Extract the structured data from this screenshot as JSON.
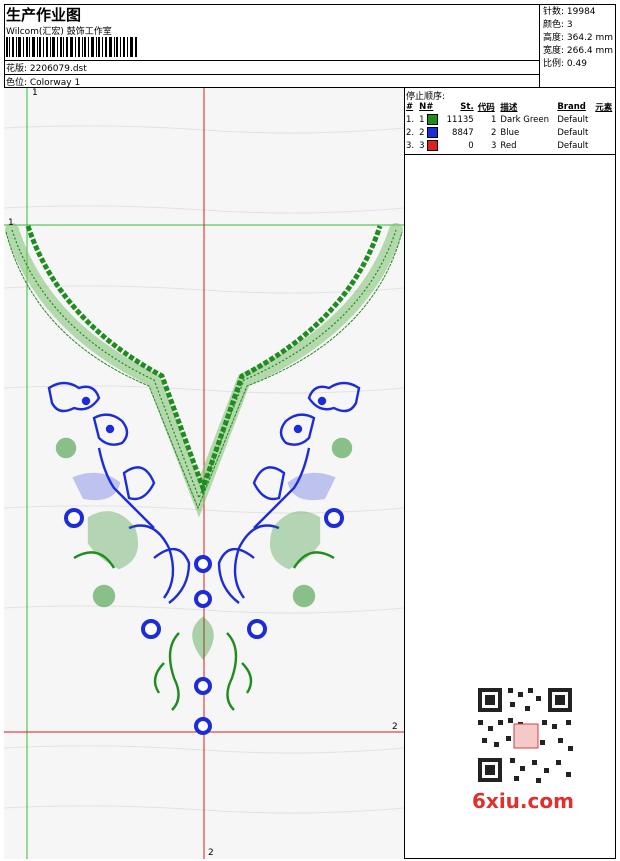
{
  "header": {
    "title": "生产作业图",
    "company": "Wilcom(汇宏) 鼓饰工作室",
    "design_file": "花版: 2206079.dst",
    "colorway": "色位: Colorway 1"
  },
  "stats": {
    "stitches": "针数: 19984",
    "colors": "颜色: 3",
    "height": "高度: 364.2 mm",
    "width": "宽度: 266.4 mm",
    "scale": "比例: 0.49"
  },
  "stop_sequence": {
    "title": "停止顺序:",
    "columns": [
      "#",
      "N#",
      "St.",
      "代码",
      "描述",
      "Brand",
      "元素"
    ],
    "rows": [
      {
        "idx": "1.",
        "n": "1",
        "color": "#1e8c1e",
        "st": "11135",
        "code": "1",
        "desc": "Dark Green",
        "brand": "Default",
        "elem": ""
      },
      {
        "idx": "2.",
        "n": "2",
        "color": "#1c2cd8",
        "st": "8847",
        "code": "2",
        "desc": "Blue",
        "brand": "Default",
        "elem": ""
      },
      {
        "idx": "3.",
        "n": "3",
        "color": "#e02020",
        "st": "0",
        "code": "3",
        "desc": "Red",
        "brand": "Default",
        "elem": ""
      }
    ]
  },
  "guides": {
    "g1_top": "1",
    "g1_left": "1",
    "g2_right": "2",
    "g2_bottom": "2"
  },
  "watermark": "6xiu.com",
  "colors": {
    "green": "#1e8c1e",
    "blue": "#1c2cd8",
    "red": "#e02020",
    "guide_green": "#30c030",
    "guide_red": "#d02020"
  }
}
